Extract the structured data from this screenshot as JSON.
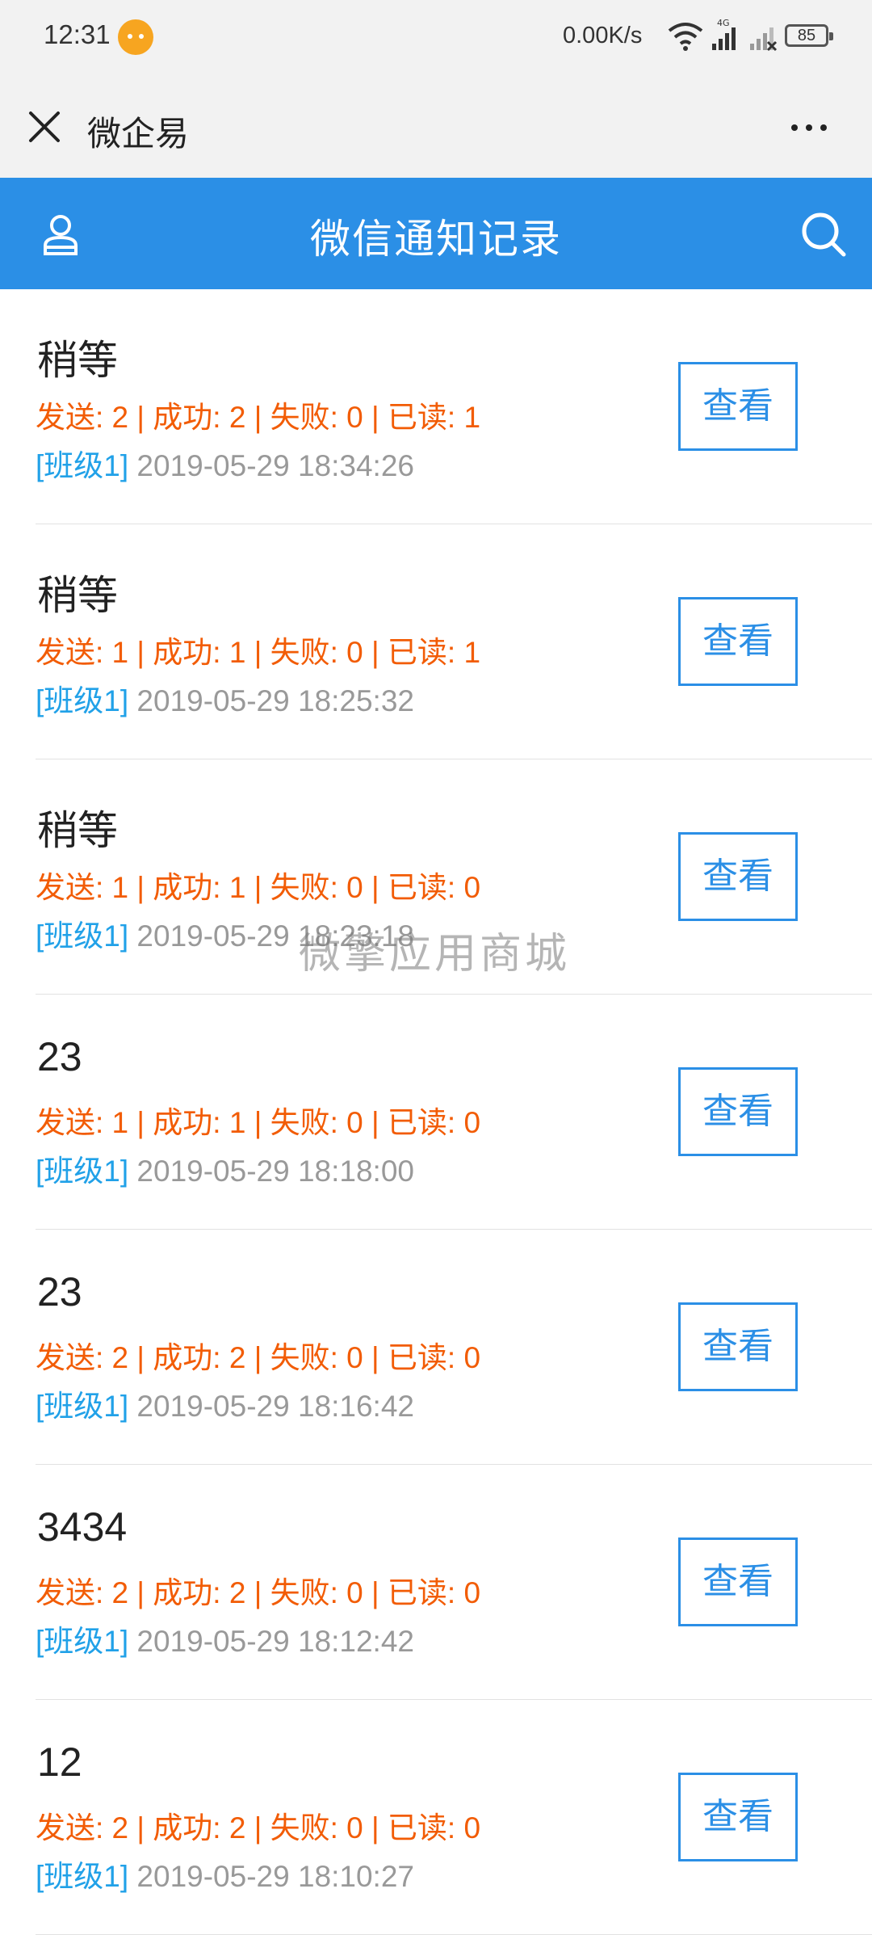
{
  "status_bar": {
    "time": "12:31",
    "network_speed": "0.00K/s",
    "battery": "85",
    "icons": [
      "notification-icon",
      "wifi-icon",
      "signal-4g-icon",
      "signal-icon",
      "battery-icon"
    ]
  },
  "titlebar": {
    "app_name": "微企易"
  },
  "header": {
    "title": "微信通知记录",
    "background": "#2b8fe6"
  },
  "records": [
    {
      "title": "稍等",
      "stats": "发送: 2 | 成功: 2 | 失败: 0 | 已读: 1",
      "class_tag": "[班级1]",
      "time": "2019-05-29 18:34:26",
      "action": "查看"
    },
    {
      "title": "稍等",
      "stats": "发送: 1 | 成功: 1 | 失败: 0 | 已读: 1",
      "class_tag": "[班级1]",
      "time": "2019-05-29 18:25:32",
      "action": "查看"
    },
    {
      "title": "稍等",
      "stats": "发送: 1 | 成功: 1 | 失败: 0 | 已读: 0",
      "class_tag": "[班级1]",
      "time": "2019-05-29 18:23:18",
      "action": "查看"
    },
    {
      "title": "23",
      "stats": "发送: 1 | 成功: 1 | 失败: 0 | 已读: 0",
      "class_tag": "[班级1]",
      "time": "2019-05-29 18:18:00",
      "action": "查看"
    },
    {
      "title": "23",
      "stats": "发送: 2 | 成功: 2 | 失败: 0 | 已读: 0",
      "class_tag": "[班级1]",
      "time": "2019-05-29 18:16:42",
      "action": "查看"
    },
    {
      "title": "3434",
      "stats": "发送: 2 | 成功: 2 | 失败: 0 | 已读: 0",
      "class_tag": "[班级1]",
      "time": "2019-05-29 18:12:42",
      "action": "查看"
    },
    {
      "title": "12",
      "stats": "发送: 2 | 成功: 2 | 失败: 0 | 已读: 0",
      "class_tag": "[班级1]",
      "time": "2019-05-29 18:10:27",
      "action": "查看"
    }
  ],
  "watermark": "微擎应用商城",
  "colors": {
    "stats": "#f25c05",
    "class_tag": "#21a1e8",
    "timestamp": "#999999"
  }
}
